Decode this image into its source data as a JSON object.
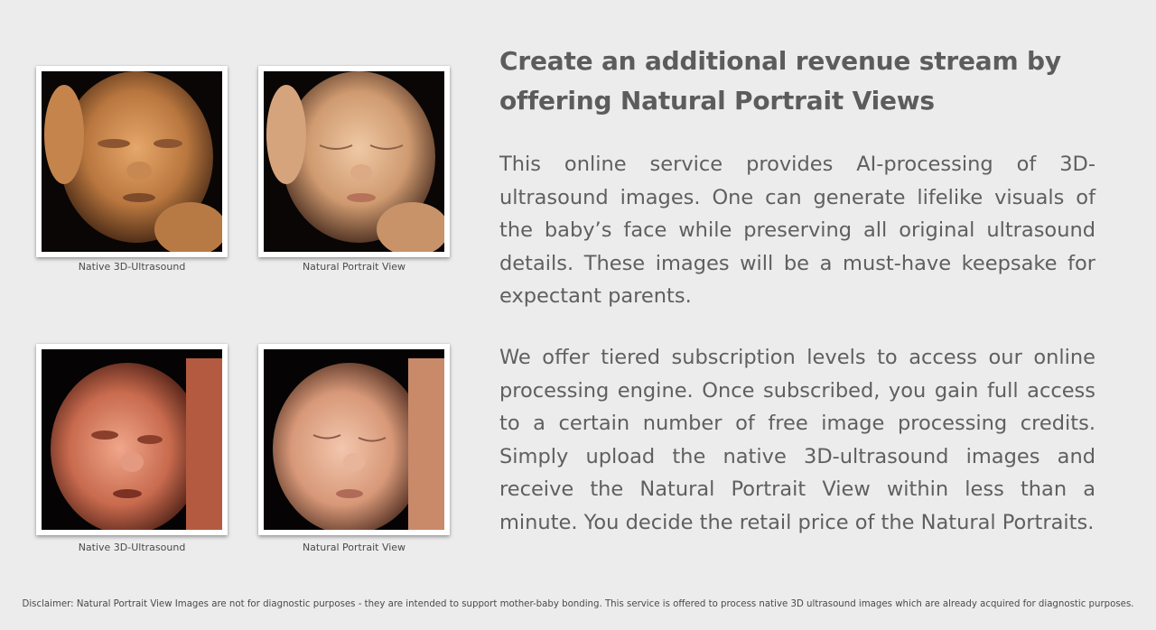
{
  "headline": "Create an additional revenue stream by offering Natural Portrait Views",
  "paragraphs": {
    "p1": "This online service provides AI-processing of 3D-ultrasound images. One can generate lifelike visuals of the baby’s face while preserving all original ultrasound details. These images will be a must-have keepsake for expectant parents.",
    "p2": "We offer tiered subscription levels to access our online processing engine. Once subscribed, you gain full access to a certain number of free image processing credits. Simply upload the native 3D-ultrasound images and receive the Natural Portrait View within less than a minute. You decide the retail price of the Natural Portraits."
  },
  "images": [
    {
      "caption": "Native 3D-Ultrasound"
    },
    {
      "caption": "Natural Portrait View"
    },
    {
      "caption": "Native 3D-Ultrasound"
    },
    {
      "caption": "Natural Portrait View"
    }
  ],
  "disclaimer": "Disclaimer: Natural Portrait View Images are not for diagnostic purposes - they are intended to support mother-baby bonding. This service is offered to process native 3D ultrasound images which are already acquired for diagnostic purposes.",
  "colors": {
    "background": "#ececed",
    "text": "#5c5c5c",
    "ultrasound_tone": "#c98a52",
    "portrait_tone": "#d8a47e"
  }
}
